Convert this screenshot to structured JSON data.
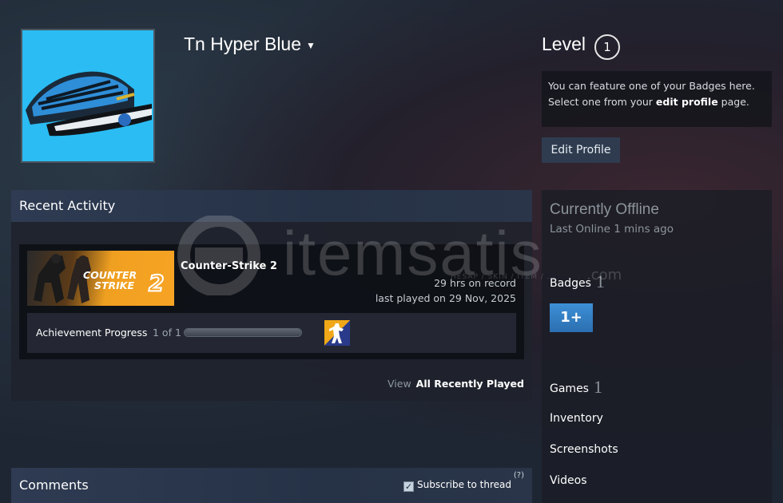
{
  "profile": {
    "persona_name": "Tn Hyper Blue",
    "level_label": "Level",
    "level": "1",
    "badge_text_1": "You can feature one of your Badges here.",
    "badge_text_2a": "Select one from your ",
    "badge_text_link": "edit profile",
    "badge_text_2b": " page.",
    "edit_button": "Edit Profile"
  },
  "recent_activity": {
    "title": "Recent Activity",
    "game": {
      "name": "Counter-Strike 2",
      "cover_text_1": "COUNTER",
      "cover_text_2": "STRIKE",
      "cover_number": "2",
      "hours": "29 hrs on record",
      "last_played": "last played on 29 Nov, 2025"
    },
    "achievement": {
      "label": "Achievement Progress",
      "count": "1 of 1",
      "progress": 1.0
    },
    "view_label": "View",
    "view_link": "All Recently Played"
  },
  "comments": {
    "title": "Comments",
    "subscribe": "Subscribe to thread",
    "help": "(?)"
  },
  "sidebar": {
    "status": "Currently Offline",
    "last_online": "Last Online 1 mins ago",
    "badges_label": "Badges",
    "badges_count": "1",
    "badge_icon_text": "1+",
    "games_label": "Games",
    "games_count": "1",
    "inventory": "Inventory",
    "screenshots": "Screenshots",
    "videos": "Videos"
  },
  "watermark": {
    "text": "itemsatis",
    "sub": "HESAP / SKIN / ITEM / ...",
    "domain": ".com"
  },
  "colors": {
    "avatar_bg": "#2bbcf3",
    "panel_header": "#2e3b52",
    "button_bg": "#2f3c4f",
    "badge_blue": "#3d8fd6"
  }
}
